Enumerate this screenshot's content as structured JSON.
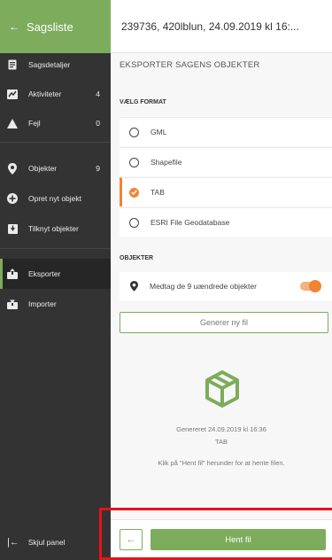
{
  "sidebar": {
    "header": {
      "back_icon": "arrow-left-icon",
      "title": "Sagsliste"
    },
    "items": [
      {
        "icon": "document-icon",
        "label": "Sagsdetaljer",
        "count": ""
      },
      {
        "icon": "activity-icon",
        "label": "Aktiviteter",
        "count": "4"
      },
      {
        "icon": "warning-icon",
        "label": "Fejl",
        "count": "0"
      },
      {
        "icon": "map-pin-icon",
        "label": "Objekter",
        "count": "9"
      },
      {
        "icon": "plus-circle-icon",
        "label": "Opret nyt objekt",
        "count": ""
      },
      {
        "icon": "download-icon",
        "label": "Tilknyt objekter",
        "count": ""
      },
      {
        "icon": "export-icon",
        "label": "Eksporter",
        "count": ""
      },
      {
        "icon": "import-icon",
        "label": "Importer",
        "count": ""
      }
    ],
    "hide_panel": {
      "icon": "collapse-left-icon",
      "label": "Skjul panel"
    }
  },
  "main": {
    "header_title": "239736, 420lblun, 24.09.2019 kl 16:...",
    "section_title": "EKSPORTER SAGENS OBJEKTER",
    "format_label": "VÆLG FORMAT",
    "formats": [
      {
        "label": "GML",
        "selected": false
      },
      {
        "label": "Shapefile",
        "selected": false
      },
      {
        "label": "TAB",
        "selected": true
      },
      {
        "label": "ESRI File Geodatabase",
        "selected": false
      }
    ],
    "objects_label": "OBJEKTER",
    "objects_option": {
      "icon": "map-pin-icon",
      "label": "Medtag de 9 uændrede objekter",
      "enabled": true
    },
    "generate_button": "Generer ny fil",
    "package_icon": "package-icon",
    "generated_text": "Genereret 24.09.2019 kl 16:36",
    "generated_format": "TAB",
    "hint_text": "Klik på \"Hent fil\" herunder for at hente filen.",
    "footer": {
      "back_icon": "arrow-left-icon",
      "download_button": "Hent fil"
    }
  },
  "colors": {
    "accent_green": "#7cac5c",
    "accent_orange": "#ee8535",
    "sidebar_bg": "#333333",
    "highlight_red": "#e8111a"
  }
}
